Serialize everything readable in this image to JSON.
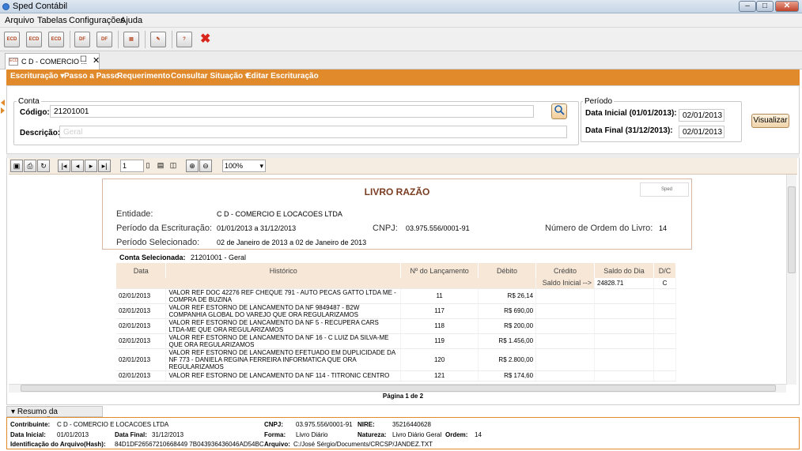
{
  "window": {
    "title": "Sped Contábil"
  },
  "menu": [
    "Arquivo",
    "Tabelas",
    "Configurações",
    "Ajuda"
  ],
  "toolbar": [
    {
      "icon": "eco-icon",
      "label": "ECD"
    },
    {
      "icon": "eco-icon",
      "label": "ECD"
    },
    {
      "icon": "eco-icon",
      "label": "ECD"
    },
    {
      "icon": "dfc-icon",
      "label": "DF"
    },
    {
      "icon": "dfc-icon",
      "label": "DF"
    },
    {
      "icon": "report-icon",
      "label": ""
    },
    {
      "icon": "edit-icon",
      "label": ""
    },
    {
      "icon": "help-icon",
      "label": ""
    },
    {
      "icon": "close-icon",
      "label": "✖"
    }
  ],
  "tab": {
    "label": "C D - COMERCIO ...",
    "icon_label": "ECD"
  },
  "nav": [
    "Escrituração",
    "Passo a Passo",
    "Requerimento",
    "Consultar Situação",
    "Editar Escrituração"
  ],
  "conta": {
    "legend": "Conta",
    "codigo_label": "Código:",
    "codigo_value": "21201001",
    "descricao_label": "Descrição:",
    "descricao_value": "Geral"
  },
  "periodo": {
    "legend": "Período",
    "inicial_label": "Data Inicial (01/01/2013):",
    "inicial_value": "02/01/2013",
    "final_label": "Data Final (31/12/2013):",
    "final_value": "02/01/2013"
  },
  "visualizar": "Visualizar",
  "viewer": {
    "page": "1",
    "zoom": "100%",
    "page_info": "Página 1 de 2"
  },
  "report": {
    "title": "LIVRO RAZÃO",
    "logo": "Sped",
    "entidade_label": "Entidade:",
    "entidade_value": "C D - COMERCIO E LOCACOES LTDA",
    "periodo_escr_label": "Período da Escrituração:",
    "periodo_escr_value": "01/01/2013 a 31/12/2013",
    "cnpj_label": "CNPJ:",
    "cnpj_value": "03.975.556/0001-91",
    "ordem_label": "Número de Ordem do Livro:",
    "ordem_value": "14",
    "periodo_sel_label": "Período Selecionado:",
    "periodo_sel_value": "02 de Janeiro de 2013 a 02 de Janeiro de 2013",
    "conta_sel_label": "Conta Selecionada:",
    "conta_sel_value": "21201001 - Geral",
    "columns": [
      "Data",
      "Histórico",
      "Nº do Lançamento",
      "Débito",
      "Crédito",
      "Saldo do Dia",
      "D/C"
    ],
    "saldo_inicial_label": "Saldo Inicial -->",
    "saldo_inicial_value": "24828.71",
    "saldo_inicial_dc": "C",
    "rows": [
      {
        "data": "02/01/2013",
        "historico": "VALOR REF DOC 42276 REF CHEQUE 791 - AUTO PECAS GATTO LTDA ME - COMPRA DE BUZINA",
        "lanc": "11",
        "debito": "R$ 26,14"
      },
      {
        "data": "02/01/2013",
        "historico": "VALOR REF ESTORNO DE LANCAMENTO DA NF 9849487 - B2W COMPANHIA GLOBAL DO VAREJO QUE ORA REGULARIZAMOS",
        "lanc": "117",
        "debito": "R$ 690,00"
      },
      {
        "data": "02/01/2013",
        "historico": "VALOR REF ESTORNO DE LANCAMENTO DA NF 5 - RECUPERA CARS LTDA-ME QUE ORA REGULARIZAMOS",
        "lanc": "118",
        "debito": "R$ 200,00"
      },
      {
        "data": "02/01/2013",
        "historico": "VALOR REF ESTORNO DE LANCAMENTO DA NF 16 - C LUIZ DA SILVA-ME QUE ORA REGULARIZAMOS",
        "lanc": "119",
        "debito": "R$ 1.456,00"
      },
      {
        "data": "02/01/2013",
        "historico": "VALOR REF ESTORNO DE LANCAMENTO EFETUADO EM DUPLICIDADE DA NF 773 - DANIELA REGINA FERREIRA INFORMATICA QUE ORA REGULARIZAMOS",
        "lanc": "120",
        "debito": "R$ 2.800,00"
      },
      {
        "data": "02/01/2013",
        "historico": "VALOR REF ESTORNO DE LANCAMENTO DA NF 114 - TITRONIC CENTRO",
        "lanc": "121",
        "debito": "R$ 174,60"
      }
    ]
  },
  "resumo": {
    "tab": "Resumo da Escrituração",
    "contribuinte_label": "Contribuinte:",
    "contribuinte_value": "C D - COMERCIO E LOCACOES LTDA",
    "cnpj_label": "CNPJ:",
    "cnpj_value": "03.975.556/0001-91",
    "nire_label": "NIRE:",
    "nire_value": "35216440628",
    "data_inicial_label": "Data Inicial:",
    "data_inicial_value": "01/01/2013",
    "data_final_label": "Data Final:",
    "data_final_value": "31/12/2013",
    "forma_label": "Forma:",
    "forma_value": "Livro Diário",
    "natureza_label": "Natureza:",
    "natureza_value": "Livro Diário Geral",
    "ordem_label": "Ordem:",
    "ordem_value": "14",
    "hash_label": "Identificação do Arquivo(Hash):",
    "hash_value": "84D1DF26567210668449 7B043936436046AD54BC",
    "arquivo_label": "Arquivo:",
    "arquivo_value": "C:/José Sérgio/Documents/CRCSP/JANDEZ.TXT"
  }
}
